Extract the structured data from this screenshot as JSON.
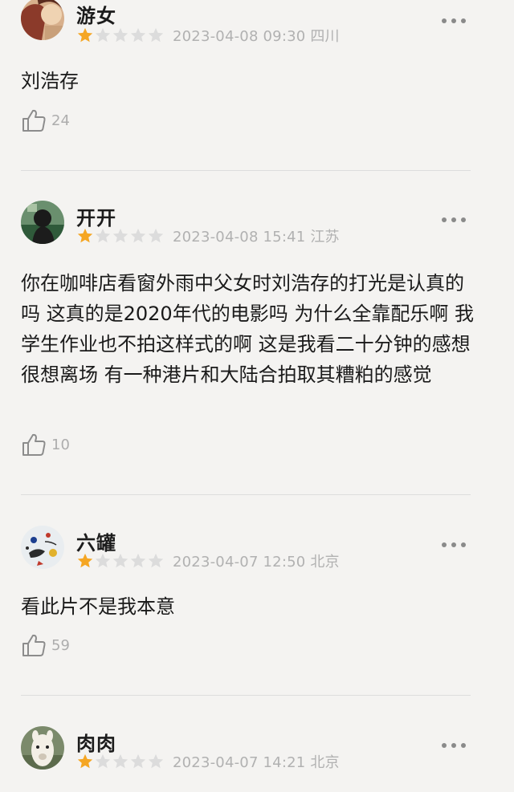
{
  "reviews": [
    {
      "username": "游女",
      "rating": 1,
      "max_rating": 5,
      "meta": "2023-04-08 09:30 四川",
      "content": "刘浩存",
      "likes": "24"
    },
    {
      "username": "开开",
      "rating": 1,
      "max_rating": 5,
      "meta": "2023-04-08 15:41 江苏",
      "content": "你在咖啡店看窗外雨中父女时刘浩存的打光是认真的吗 这真的是2020年代的电影吗 为什么全靠配乐啊 我学生作业也不拍这样式的啊 这是我看二十分钟的感想 很想离场 有一种港片和大陆合拍取其糟粕的感觉",
      "likes": "10"
    },
    {
      "username": "六罐",
      "rating": 1,
      "max_rating": 5,
      "meta": "2023-04-07 12:50 北京",
      "content": "看此片不是我本意",
      "likes": "59"
    },
    {
      "username": "肉肉",
      "rating": 1,
      "max_rating": 5,
      "meta": "2023-04-07 14:21 北京",
      "content": "",
      "likes": ""
    }
  ],
  "colors": {
    "star_filled": "#f5a623",
    "star_empty": "#dcdcdc",
    "background": "#f4f3f1"
  },
  "icons": {
    "more": "more-dots-icon",
    "like": "thumbs-up-icon",
    "star": "star-icon"
  }
}
